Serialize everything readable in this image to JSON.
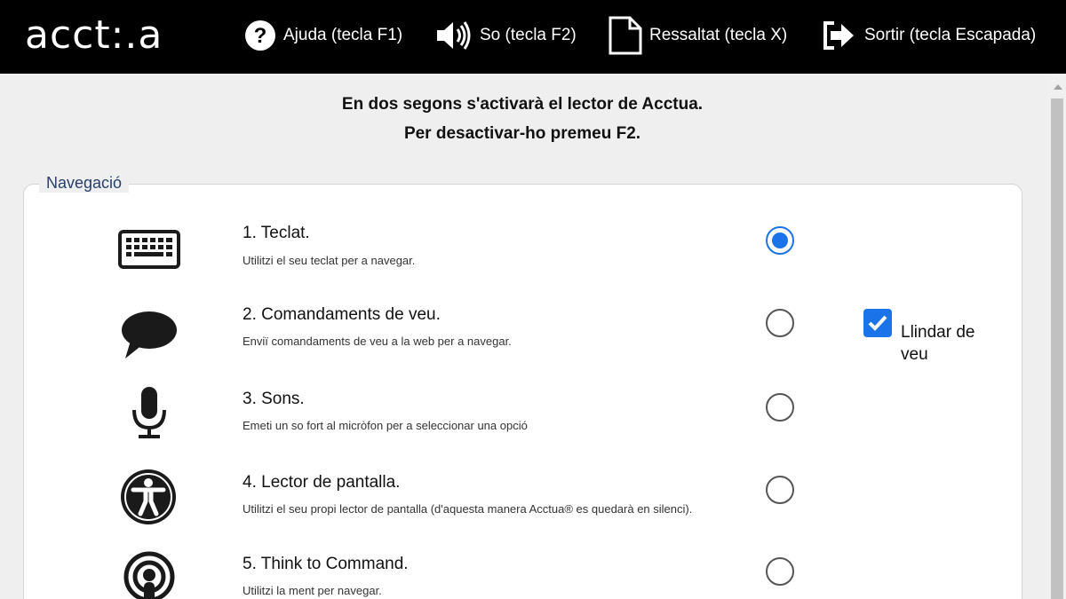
{
  "app": {
    "logo": "acct:.a"
  },
  "menu": [
    {
      "label": "Ajuda (tecla F1)",
      "icon": "help-icon"
    },
    {
      "label": "So (tecla F2)",
      "icon": "speaker-icon"
    },
    {
      "label": "Ressaltat (tecla X)",
      "icon": "document-icon"
    },
    {
      "label": "Sortir (tecla Escapada)",
      "icon": "exit-icon"
    }
  ],
  "notice": {
    "line1": "En dos segons s'activarà el lector de Acctua.",
    "line2": "Per desactivar-ho premeu F2."
  },
  "navigation": {
    "legend": "Navegació",
    "options": [
      {
        "title": "1. Teclat.",
        "description": "Utilitzi el seu teclat per a navegar.",
        "icon": "keyboard-icon",
        "selected": true
      },
      {
        "title": "2. Comandaments de veu.",
        "description": "Enviï comandaments de veu a la web per a navegar.",
        "icon": "speech-bubble-icon",
        "selected": false
      },
      {
        "title": "3. Sons.",
        "description": "Emeti un so fort al micròfon per a seleccionar una opció",
        "icon": "microphone-icon",
        "selected": false
      },
      {
        "title": "4. Lector de pantalla.",
        "description": "Utilitzi el seu propi lector de pantalla (d'aquesta manera Acctua® es quedarà en silenci).",
        "icon": "accessibility-icon",
        "selected": false
      },
      {
        "title": "5. Think to Command.",
        "description": "Utilitzi la ment per navegar.",
        "icon": "podcast-icon",
        "selected": false
      }
    ],
    "voice_threshold": {
      "label": "Llindar de veu",
      "checked": true
    }
  },
  "colors": {
    "topbar": "#000000",
    "accent": "#1a73e8",
    "legend": "#27406a"
  }
}
